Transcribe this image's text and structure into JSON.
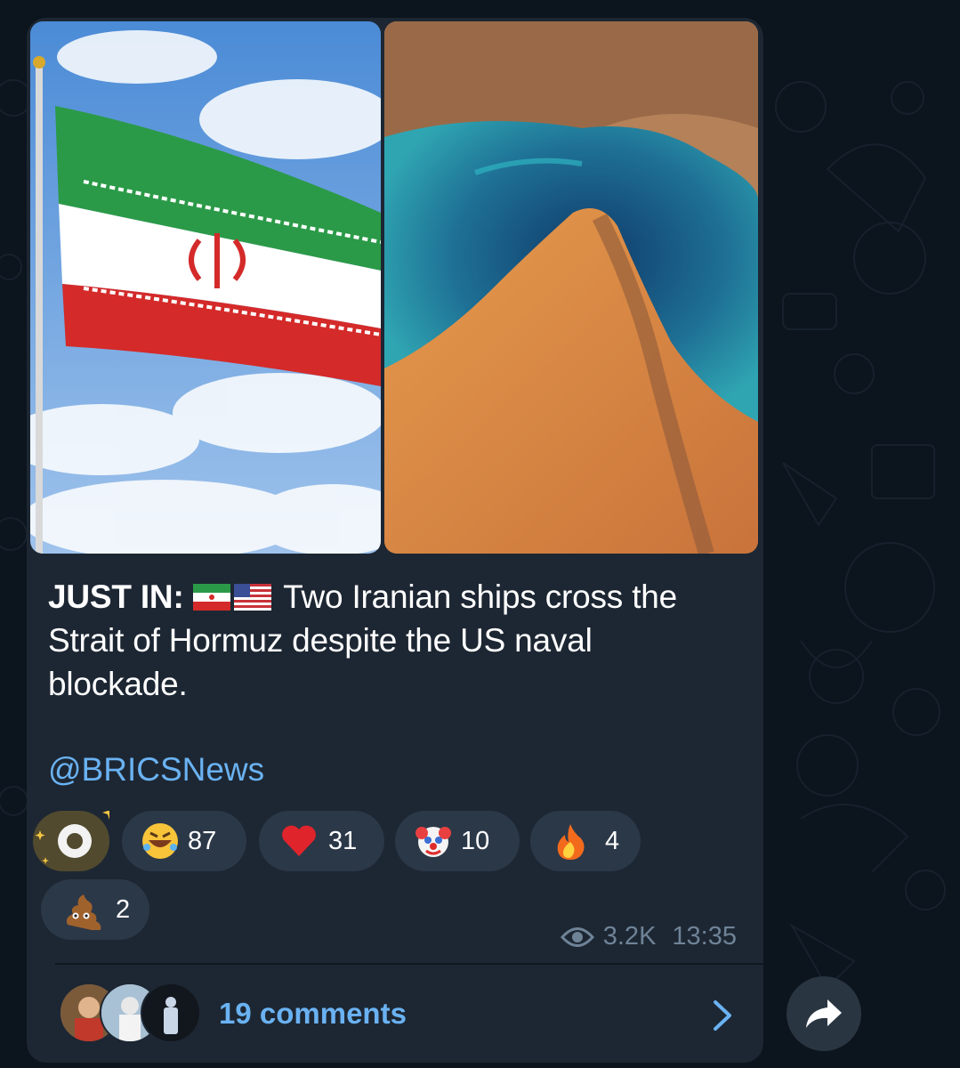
{
  "post": {
    "caption_prefix": "JUST IN:",
    "caption_text": "Two Iranian ships cross the Strait of Hormuz despite the US naval blockade.",
    "handle": "@BRICSNews"
  },
  "reactions": [
    {
      "emoji": "rolling-on-floor-laughing",
      "count": "87"
    },
    {
      "emoji": "red-heart",
      "count": "31"
    },
    {
      "emoji": "clown-face",
      "count": "10"
    },
    {
      "emoji": "fire",
      "count": "4"
    },
    {
      "emoji": "pile-of-poo",
      "count": "2"
    }
  ],
  "meta": {
    "views": "3.2K",
    "time": "13:35"
  },
  "comments": {
    "label": "19 comments"
  },
  "colors": {
    "background": "#0c141d",
    "bubble": "#1d2733",
    "chip": "#2b3848",
    "link": "#6ab2f2",
    "meta": "#6f8397"
  }
}
